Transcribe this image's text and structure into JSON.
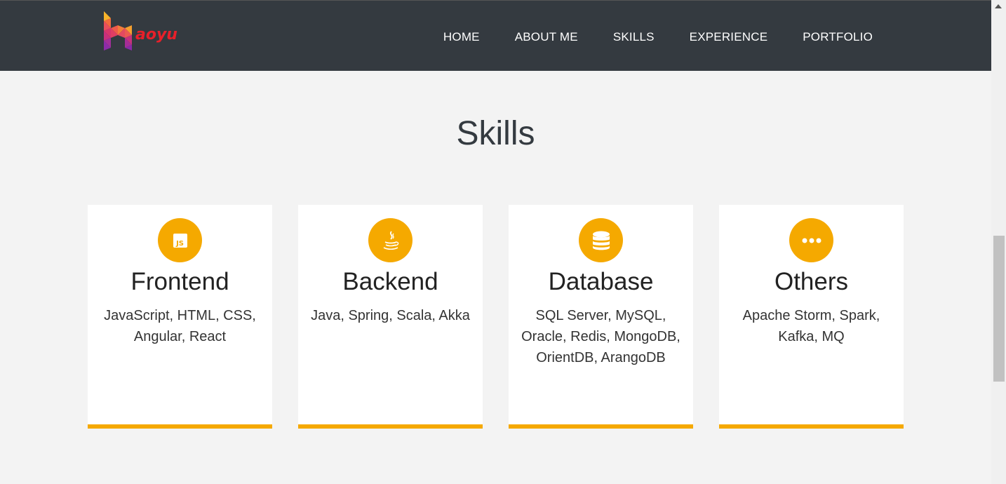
{
  "header": {
    "logo_text": "aoyu",
    "nav": [
      "HOME",
      "ABOUT ME",
      "SKILLS",
      "EXPERIENCE",
      "PORTFOLIO"
    ]
  },
  "skills": {
    "title": "Skills",
    "cards": [
      {
        "icon": "js-icon",
        "title": "Frontend",
        "text": "JavaScript, HTML, CSS, Angular, React"
      },
      {
        "icon": "java-icon",
        "title": "Backend",
        "text": "Java, Spring, Scala, Akka"
      },
      {
        "icon": "database-icon",
        "title": "Database",
        "text": "SQL Server, MySQL, Oracle, Redis, MongoDB, OrientDB, ArangoDB"
      },
      {
        "icon": "ellipsis-icon",
        "title": "Others",
        "text": "Apache Storm, Spark, Kafka, MQ"
      }
    ]
  },
  "colors": {
    "nav_bg": "#343a40",
    "accent": "#f5a900",
    "page_bg": "#f3f3f3",
    "logo_text": "#e8202a"
  }
}
